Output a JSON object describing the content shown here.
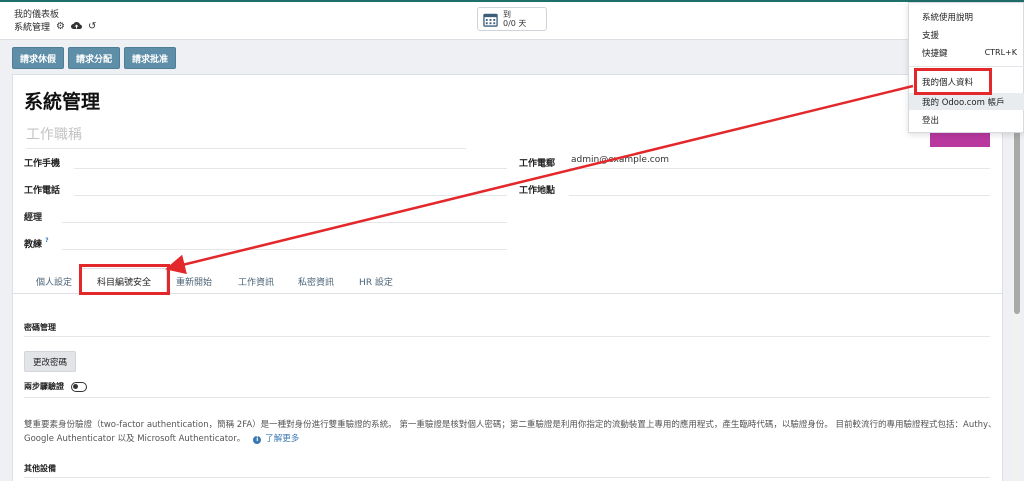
{
  "breadcrumb": {
    "parent": "我的儀表板",
    "current": "系統管理"
  },
  "breadcrumb_icons": [
    "gear-icon",
    "cloud-upload-icon",
    "undo-icon"
  ],
  "attendance": {
    "line1": "到",
    "line2": "0/0 天"
  },
  "control_panel": {
    "buttons": [
      "請求休假",
      "請求分配",
      "請求批准"
    ]
  },
  "employee": {
    "name": "系統管理",
    "job_title_placeholder": "工作職稱",
    "fields": {
      "work_mobile": {
        "label": "工作手機",
        "value": ""
      },
      "work_phone": {
        "label": "工作電話",
        "value": ""
      },
      "manager": {
        "label": "經理",
        "value": ""
      },
      "coach": {
        "label": "教練",
        "sup": "?",
        "value": ""
      },
      "work_email": {
        "label": "工作電郵",
        "value": "admin@example.com"
      },
      "work_location": {
        "label": "工作地點",
        "value": ""
      }
    }
  },
  "tabs": [
    "個人設定",
    "科目編號安全",
    "重新開始",
    "工作資訊",
    "私密資訊",
    "HR 設定"
  ],
  "active_tab": "科目編號安全",
  "security": {
    "password_section": "密碼管理",
    "change_password_button": "更改密碼",
    "two_factor_label": "兩步驟驗證",
    "description": "雙重要素身份驗證（two-factor authentication，簡稱 2FA）是一種對身份進行雙重驗證的系統。 第一重驗證是核對個人密碼；第二重驗證是利用你指定的流動裝置上專用的應用程式，產生臨時代碼，以驗證身份。 目前較流行的專用驗證程式包括：Authy、Google Authenticator 以及 Microsoft Authenticator。",
    "learn_more": "了解更多",
    "other_devices": "其他設備"
  },
  "user_menu": {
    "items": [
      "系統使用說明",
      "支援",
      "快捷鍵",
      "我的個人資料",
      "我的 Odoo.com 帳戶",
      "登出"
    ],
    "shortcut_key": "CTRL+K",
    "highlighted_item": "我的個人資料"
  },
  "colors": {
    "control_button": "#5e8ea8",
    "avatar_block": "#b9389e",
    "annotation_red": "#e3282b",
    "link_blue": "#3978b3",
    "topbar_accent": "#1e6e6a"
  }
}
